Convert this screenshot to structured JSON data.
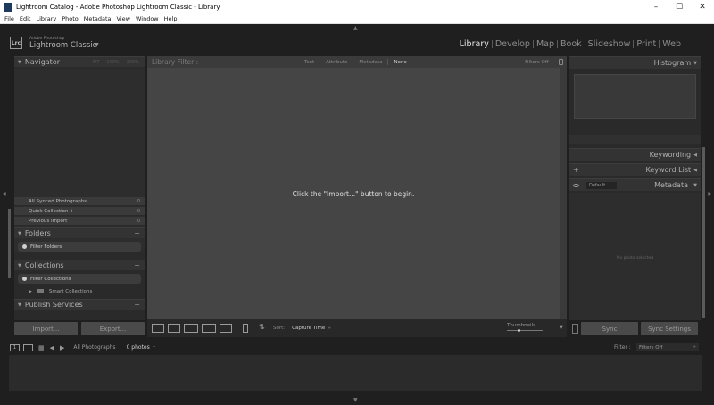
{
  "window": {
    "title": "Lightroom Catalog - Adobe Photoshop Lightroom Classic - Library",
    "controls": [
      "–",
      "☐",
      "✕"
    ]
  },
  "menu": [
    "File",
    "Edit",
    "Library",
    "Photo",
    "Metadata",
    "View",
    "Window",
    "Help"
  ],
  "brand": {
    "logo": "Lrc",
    "company": "Adobe Photoshop",
    "product": "Lightroom Classic",
    "caret": "▼"
  },
  "modules": [
    "Library",
    "Develop",
    "Map",
    "Book",
    "Slideshow",
    "Print",
    "Web"
  ],
  "active_module": "Library",
  "left_panel": {
    "navigator": {
      "title": "Navigator",
      "zoom": [
        "FIT",
        "100%",
        "200%"
      ]
    },
    "catalog": [
      {
        "label": "All Synced Photographs",
        "count": "0"
      },
      {
        "label": "Quick Collection +",
        "count": "0"
      },
      {
        "label": "Previous Import",
        "count": "0"
      }
    ],
    "folders": {
      "title": "Folders",
      "filter": "Filter Folders"
    },
    "collections": {
      "title": "Collections",
      "filter": "Filter Collections",
      "smart": "Smart Collections"
    },
    "publish": {
      "title": "Publish Services"
    },
    "import_label": "Import...",
    "export_label": "Export..."
  },
  "filter_bar": {
    "title": "Library Filter :",
    "options": [
      "Text",
      "Attribute",
      "Metadata",
      "None"
    ],
    "active": "None",
    "filters_off": "Filters Off ÷"
  },
  "grid": {
    "message": "Click the \"Import...\" button to begin."
  },
  "toolbar": {
    "sort_label": "Sort:",
    "sort_value": "Capture Time",
    "caret": "÷",
    "thumbnails_label": "Thumbnails",
    "end": "▼"
  },
  "right_panel": {
    "histogram": "Histogram",
    "keywording": "Keywording",
    "keyword_list": "Keyword List",
    "metadata": "Metadata",
    "preset": "Default",
    "no_photo_msg": "No photo selected",
    "sync_label": "Sync",
    "sync_settings_label": "Sync Settings"
  },
  "filmstrip": {
    "num": "1",
    "source": "All Photographs",
    "count": "0 photos",
    "caret": "÷",
    "filter_label": "Filter :",
    "filter_value": "Filters Off"
  }
}
